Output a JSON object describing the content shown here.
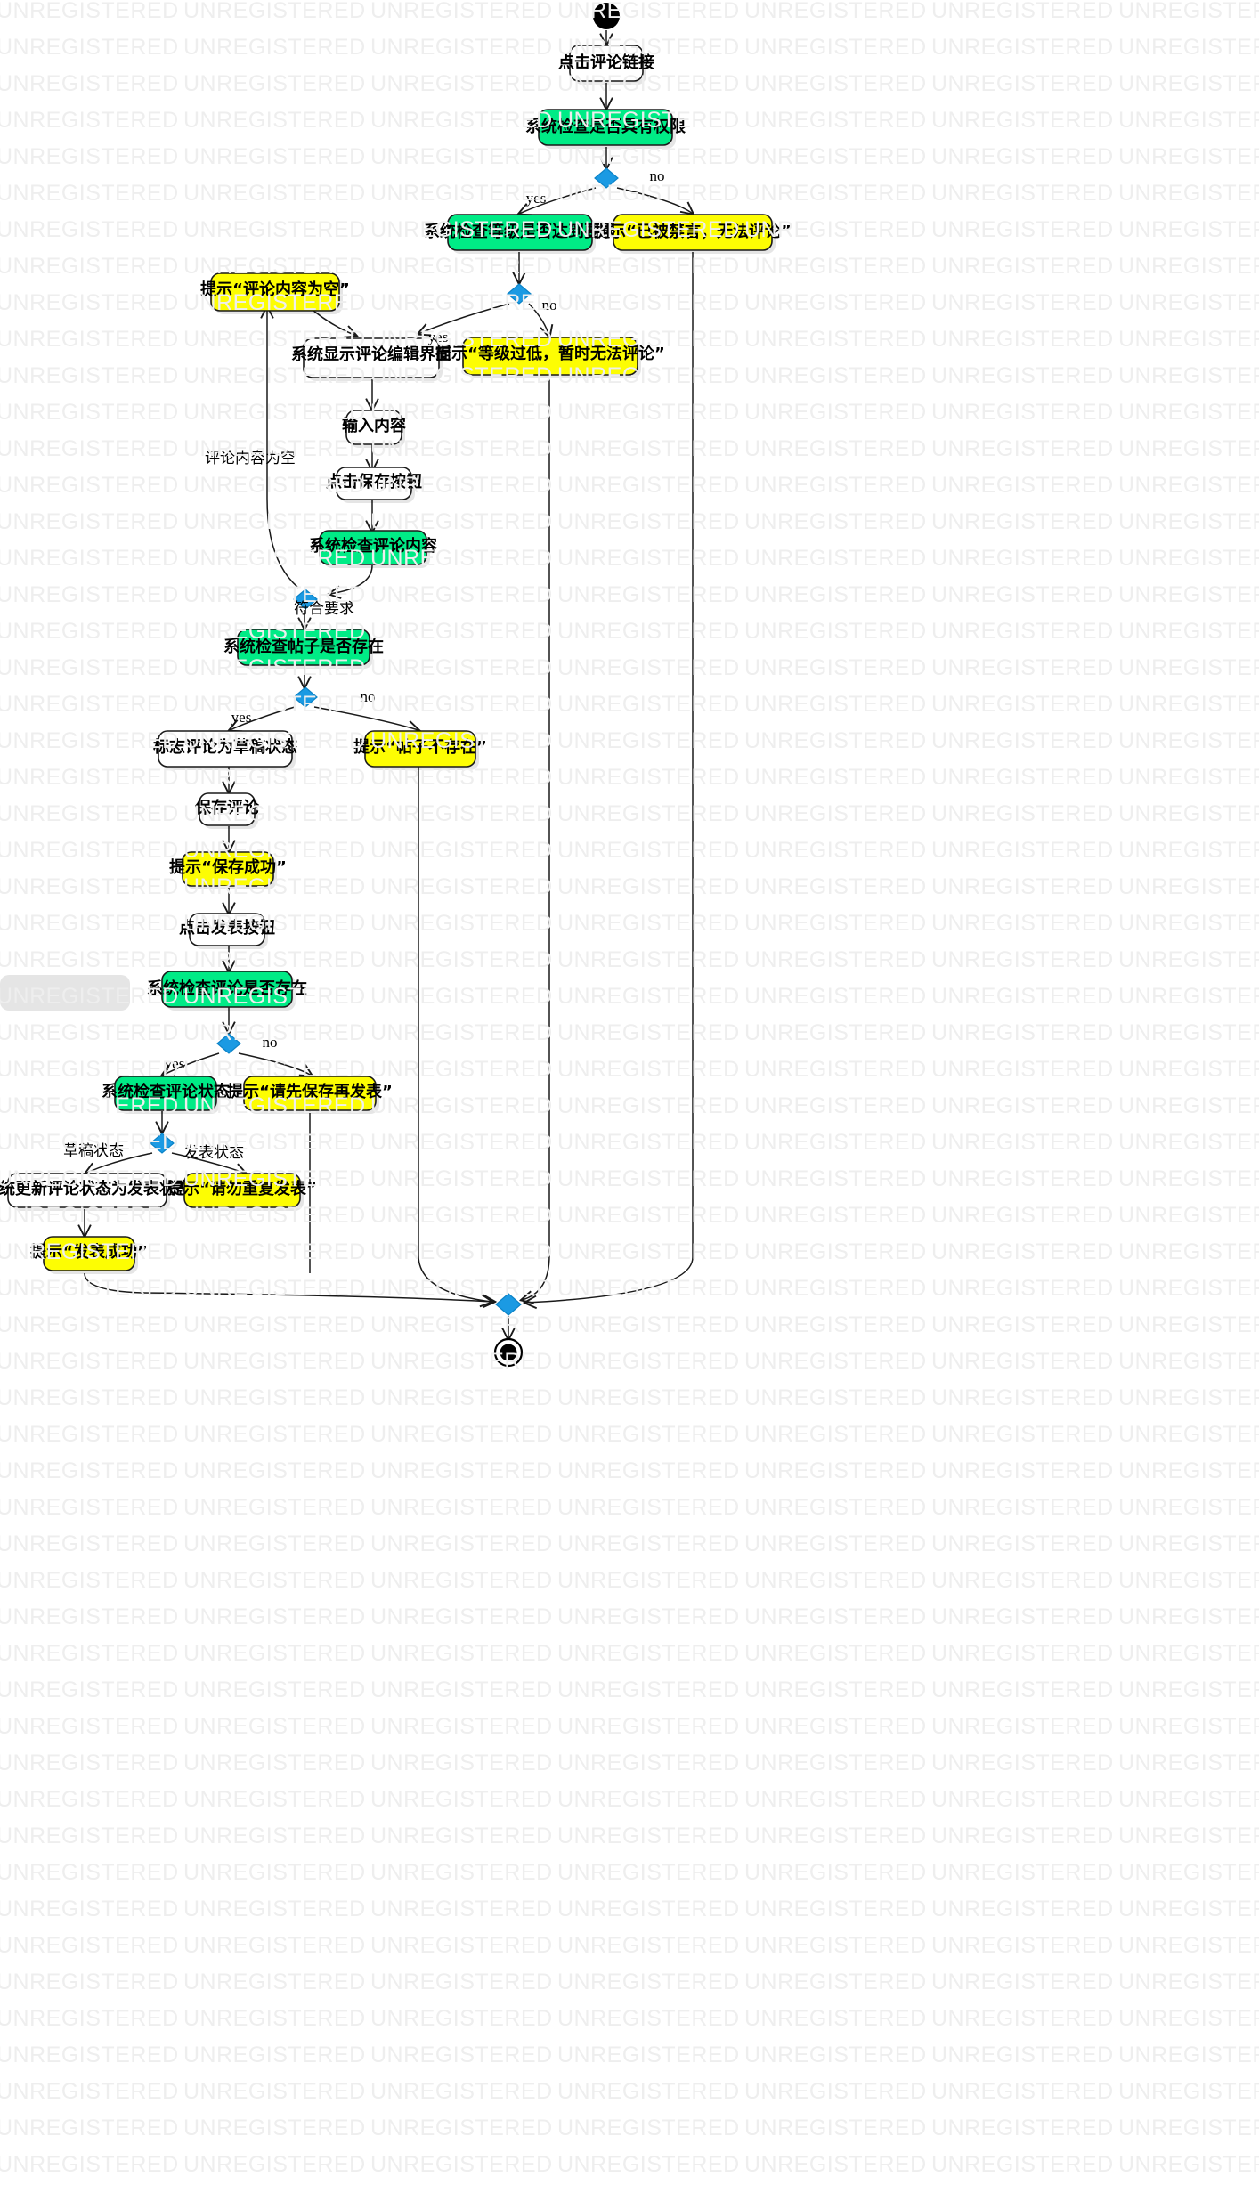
{
  "watermark": {
    "text": "UNREGISTERED",
    "color": "#eeeeee",
    "rows": 60,
    "cols": 7
  },
  "palette": {
    "green": "#00eb86",
    "yellow": "#fdfd03",
    "white": "#ffffff",
    "diamond": "#1b9ae3",
    "stroke": "#1a1a1a",
    "background": "#ffffff"
  },
  "diagram": {
    "type": "uml-activity-flowchart",
    "title": "",
    "nodes": [
      {
        "id": "start",
        "kind": "start",
        "label": ""
      },
      {
        "id": "n1",
        "kind": "action",
        "color": "white",
        "label": "点击评论链接"
      },
      {
        "id": "n2",
        "kind": "action",
        "color": "green",
        "label": "系统检查是否具有权限"
      },
      {
        "id": "d1",
        "kind": "decision",
        "label": ""
      },
      {
        "id": "n3",
        "kind": "action",
        "color": "green",
        "label": "系统检查等级是否达到要求"
      },
      {
        "id": "n4",
        "kind": "action",
        "color": "yellow",
        "label": "提示“已被禁言，无法评论”"
      },
      {
        "id": "d2",
        "kind": "decision",
        "label": ""
      },
      {
        "id": "n5",
        "kind": "action",
        "color": "white",
        "label": "系统显示评论编辑界面"
      },
      {
        "id": "n6",
        "kind": "action",
        "color": "yellow",
        "label": "提示“等级过低，暂时无法评论”"
      },
      {
        "id": "n7",
        "kind": "action",
        "color": "yellow",
        "label": "提示“评论内容为空”"
      },
      {
        "id": "n8",
        "kind": "action",
        "color": "white",
        "label": "输入内容"
      },
      {
        "id": "n9",
        "kind": "action",
        "color": "white",
        "label": "点击保存按钮"
      },
      {
        "id": "n10",
        "kind": "action",
        "color": "green",
        "label": "系统检查评论内容"
      },
      {
        "id": "d3",
        "kind": "decision",
        "label": ""
      },
      {
        "id": "n11",
        "kind": "action",
        "color": "green",
        "label": "系统检查帖子是否存在"
      },
      {
        "id": "d4",
        "kind": "decision",
        "label": ""
      },
      {
        "id": "n12",
        "kind": "action",
        "color": "white",
        "label": "标志评论为草稿状态"
      },
      {
        "id": "n13",
        "kind": "action",
        "color": "yellow",
        "label": "提示“帖子不存在”"
      },
      {
        "id": "n14",
        "kind": "action",
        "color": "white",
        "label": "保存评论"
      },
      {
        "id": "n15",
        "kind": "action",
        "color": "yellow",
        "label": "提示“保存成功”"
      },
      {
        "id": "n16",
        "kind": "action",
        "color": "white",
        "label": "点击发表按钮"
      },
      {
        "id": "n17",
        "kind": "action",
        "color": "green",
        "label": "系统检查评论是否存在"
      },
      {
        "id": "d5",
        "kind": "decision",
        "label": ""
      },
      {
        "id": "n18",
        "kind": "action",
        "color": "green",
        "label": "系统检查评论状态"
      },
      {
        "id": "n19",
        "kind": "action",
        "color": "yellow",
        "label": "提示“请先保存再发表”"
      },
      {
        "id": "d6",
        "kind": "decision",
        "label": ""
      },
      {
        "id": "n20",
        "kind": "action",
        "color": "white",
        "label": "系统更新评论状态为发表状态"
      },
      {
        "id": "n21",
        "kind": "action",
        "color": "yellow",
        "label": "提示“请勿重复发表”"
      },
      {
        "id": "n22",
        "kind": "action",
        "color": "yellow",
        "label": "提示“发表成功”"
      },
      {
        "id": "d7",
        "kind": "merge",
        "label": ""
      },
      {
        "id": "end",
        "kind": "end",
        "label": ""
      }
    ],
    "edge_labels": {
      "d1_yes": "yes",
      "d1_no": "no",
      "d2_yes": "yes",
      "d2_no": "no",
      "n5_empty": "评论内容为空",
      "d3_ok": "符合要求",
      "d4_yes": "yes",
      "d4_no": "no",
      "d5_yes": "yes",
      "d5_no": "no",
      "d6_draft": "草稿状态",
      "d6_published": "发表状态"
    }
  }
}
